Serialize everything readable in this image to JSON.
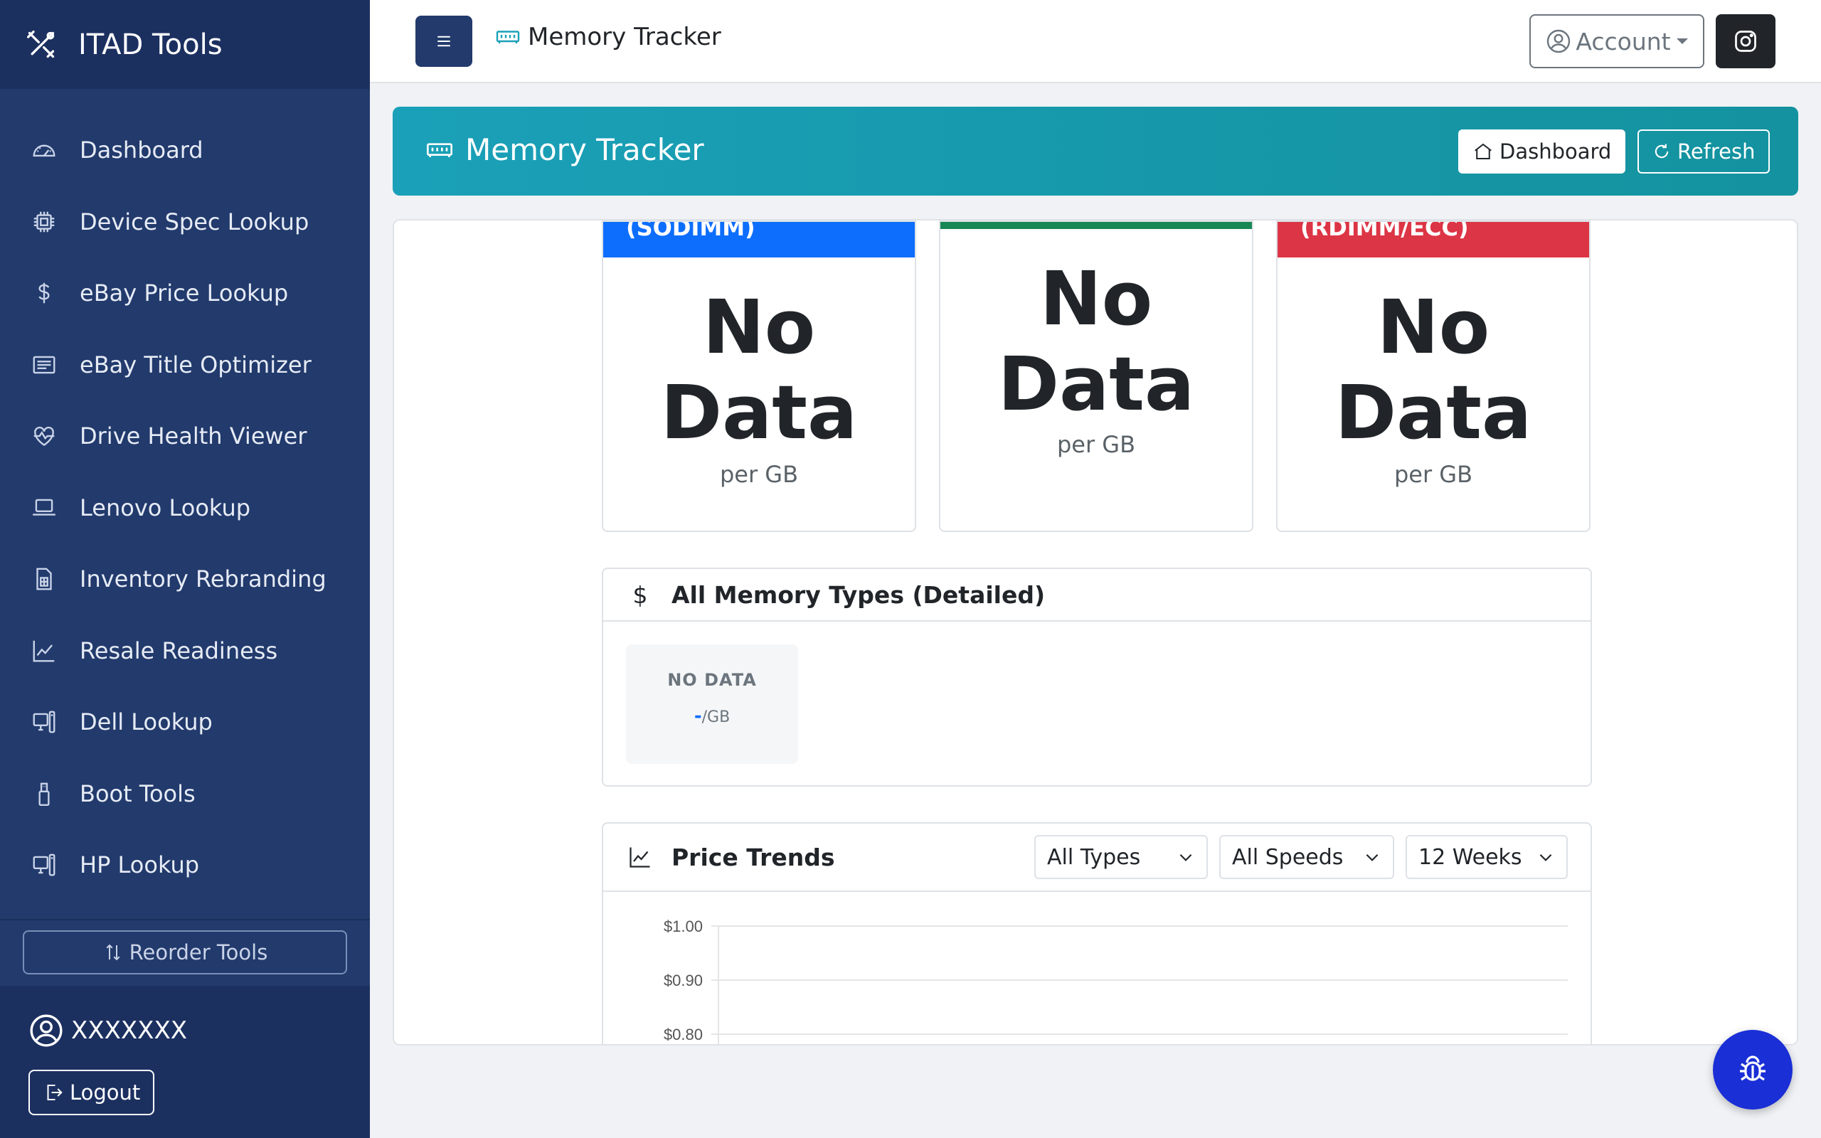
{
  "app": {
    "name": "ITAD Tools",
    "brand_icon": "tools-icon"
  },
  "sidebar": {
    "items": [
      {
        "label": "Dashboard",
        "icon": "speedometer-icon"
      },
      {
        "label": "Device Spec Lookup",
        "icon": "cpu-icon"
      },
      {
        "label": "eBay Price Lookup",
        "icon": "dollar-icon"
      },
      {
        "label": "eBay Title Optimizer",
        "icon": "card-text-icon"
      },
      {
        "label": "Drive Health Viewer",
        "icon": "heart-pulse-icon"
      },
      {
        "label": "Lenovo Lookup",
        "icon": "laptop-icon"
      },
      {
        "label": "Inventory Rebranding",
        "icon": "file-spreadsheet-icon"
      },
      {
        "label": "Resale Readiness",
        "icon": "graph-up-icon"
      },
      {
        "label": "Dell Lookup",
        "icon": "pc-display-icon"
      },
      {
        "label": "Boot Tools",
        "icon": "usb-drive-icon"
      },
      {
        "label": "HP Lookup",
        "icon": "pc-display-icon"
      }
    ],
    "reorder_label": "Reorder Tools",
    "user_name": "XXXXXXX",
    "logout_label": "Logout"
  },
  "topbar": {
    "breadcrumb": "Memory Tracker",
    "account_label": "Account"
  },
  "banner": {
    "title": "Memory Tracker",
    "dashboard_label": "Dashboard",
    "refresh_label": "Refresh"
  },
  "price_cards": [
    {
      "header": "(SODIMM)",
      "value": "No Data",
      "unit": "per GB",
      "color": "#0d6efd"
    },
    {
      "header": "",
      "value": "No Data",
      "unit": "per GB",
      "color": "#198754"
    },
    {
      "header": "(RDIMM/ECC)",
      "value": "No Data",
      "unit": "per GB",
      "color": "#dc3545"
    }
  ],
  "detailed": {
    "title": "All Memory Types (Detailed)",
    "tile_name": "NO DATA",
    "tile_value": "-",
    "tile_unit": "/GB"
  },
  "trends": {
    "title": "Price Trends",
    "type_select": "All Types",
    "speed_select": "All Speeds",
    "range_select": "12 Weeks"
  },
  "chart_data": {
    "type": "line",
    "title": "",
    "xlabel": "",
    "ylabel": "",
    "y_ticks": [
      "$1.00",
      "$0.90",
      "$0.80"
    ],
    "series": [],
    "grid": true
  },
  "colors": {
    "sidebar": "#223a6c",
    "banner": "#1aa0b8",
    "fab": "#1a2fd6"
  }
}
